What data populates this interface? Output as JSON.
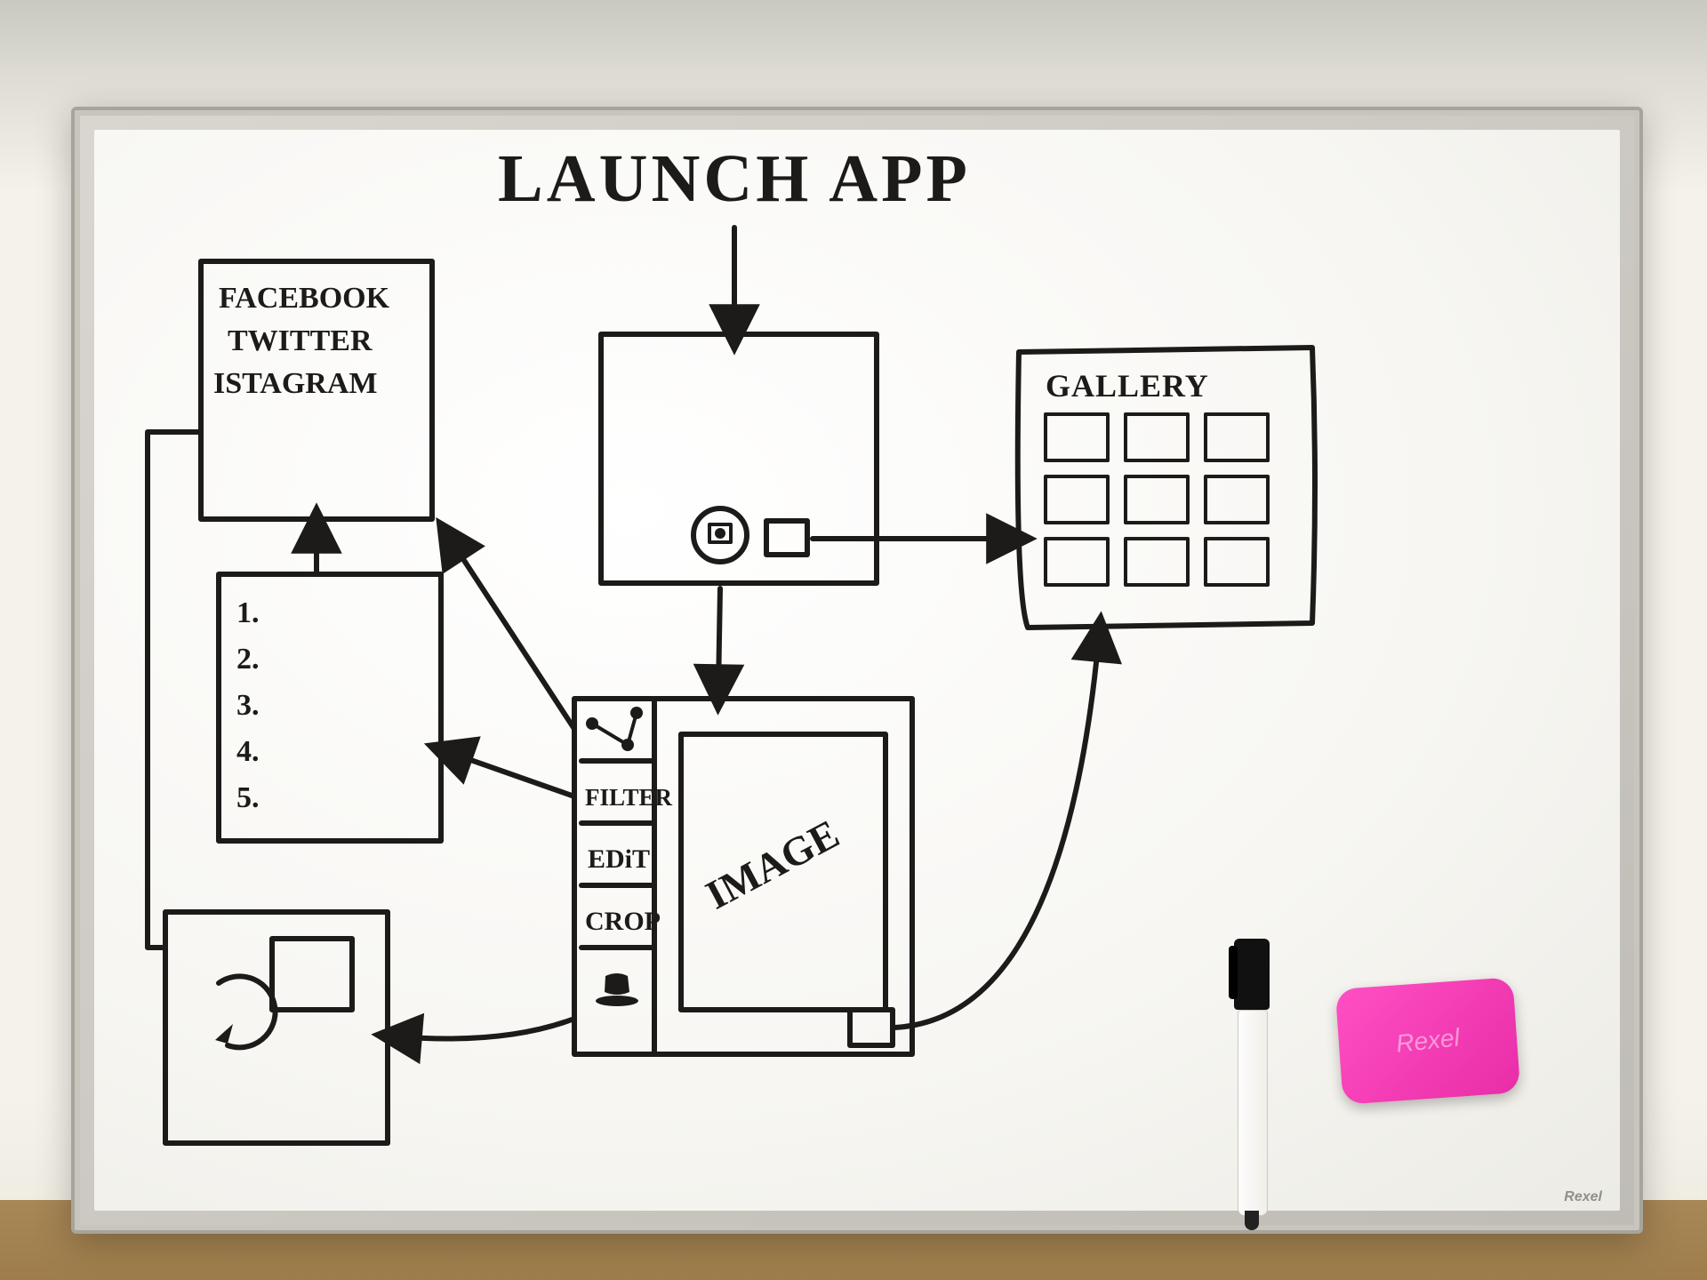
{
  "title": "LAUNCH APP",
  "social_screen": {
    "items": [
      "FACEBOOK",
      "TWITTER",
      "ISTAGRAM"
    ]
  },
  "filter_list": {
    "items": [
      "1.",
      "2.",
      "3.",
      "4.",
      "5."
    ]
  },
  "gallery": {
    "title": "GALLERY"
  },
  "edit_screen": {
    "tools": [
      "FILTER",
      "EDiT",
      "CROP"
    ],
    "preview_label": "IMAGE"
  },
  "whiteboard_brand": "Rexel",
  "eraser_brand": "Rexel"
}
